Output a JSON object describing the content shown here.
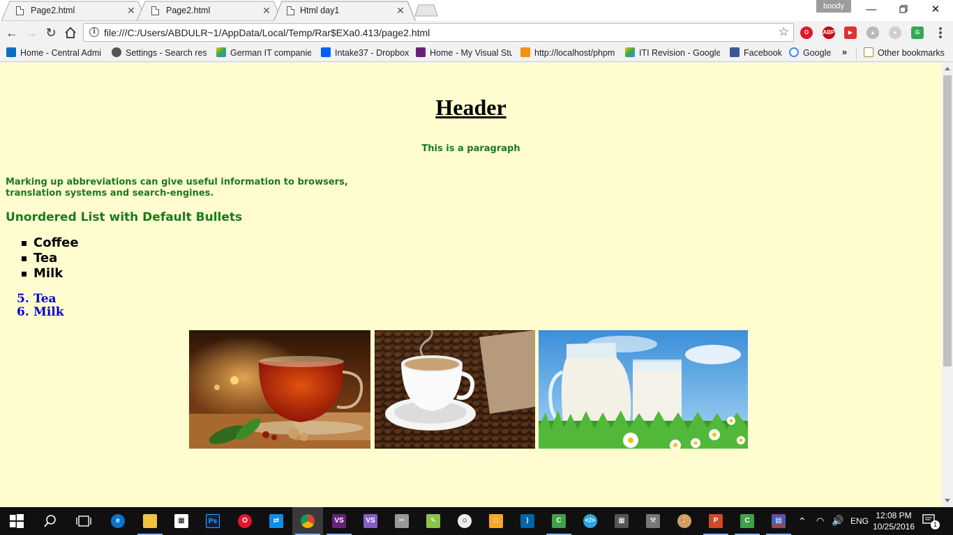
{
  "browser": {
    "tabs": [
      {
        "label": "Page2.html",
        "active": false
      },
      {
        "label": "Page2.html",
        "active": false
      },
      {
        "label": "Html day1",
        "active": true
      }
    ],
    "profile_name": "boody",
    "url": "file:///C:/Users/ABDULR~1/AppData/Local/Temp/Rar$EXa0.413/page2.html",
    "bookmarks": [
      {
        "label": "Home - Central Admi",
        "icon": "sharepoint-icon"
      },
      {
        "label": "Settings - Search resu",
        "icon": "gear-icon"
      },
      {
        "label": "German IT companies",
        "icon": "google-drive-icon"
      },
      {
        "label": "Intake37 - Dropbox",
        "icon": "dropbox-icon"
      },
      {
        "label": "Home - My Visual Stu",
        "icon": "visual-studio-icon"
      },
      {
        "label": "http://localhost/phpm",
        "icon": "phpmyadmin-icon"
      },
      {
        "label": "ITI Revision - Google",
        "icon": "google-drive-icon"
      },
      {
        "label": "Facebook",
        "icon": "facebook-icon"
      },
      {
        "label": "Google",
        "icon": "google-icon"
      }
    ],
    "bookmarks_overflow": "»",
    "other_bookmarks": "Other bookmarks"
  },
  "page": {
    "header": "Header",
    "paragraph": "This is a paragraph",
    "abbreviation_text": "Marking up abbreviations can give useful information to browsers, translation systems and search-engines.",
    "list_heading": "Unordered List with Default Bullets",
    "unordered_items": [
      "Coffee",
      "Tea",
      "Milk"
    ],
    "ordered_items": [
      {
        "number": "5.",
        "label": "Tea"
      },
      {
        "number": "6.",
        "label": "Milk"
      }
    ],
    "images": [
      "tea-cup-image",
      "coffee-cup-image",
      "milk-jug-image"
    ]
  },
  "taskbar": {
    "clock_time": "12:08 PM",
    "clock_date": "10/25/2016",
    "language": "ENG",
    "notification_count": "1"
  },
  "colors": {
    "page_background": "#fffdd0",
    "green_text": "#1b7a1b",
    "blue_list": "#0000dd"
  }
}
